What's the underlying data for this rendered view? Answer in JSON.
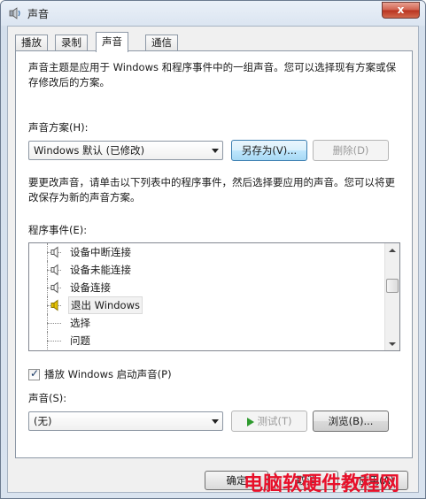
{
  "window": {
    "title": "声音",
    "close_glyph": "x"
  },
  "tabs": [
    {
      "label": "播放"
    },
    {
      "label": "录制"
    },
    {
      "label": "声音"
    },
    {
      "label": "通信"
    }
  ],
  "sound_panel": {
    "intro_text": "声音主题是应用于 Windows 和程序事件中的一组声音。您可以选择现有方案或保存修改后的方案。",
    "scheme_label": "声音方案(H):",
    "scheme_value": "Windows 默认 (已修改)",
    "save_as_label": "另存为(V)...",
    "delete_label": "删除(D)",
    "instructions_text": "要更改声音，请单击以下列表中的程序事件，然后选择要应用的声音。您可以将更改保存为新的声音方案。",
    "events_label": "程序事件(E):",
    "events": [
      {
        "label": "设备中断连接",
        "has_sound": true,
        "selected": false
      },
      {
        "label": "设备未能连接",
        "has_sound": true,
        "selected": false
      },
      {
        "label": "设备连接",
        "has_sound": true,
        "selected": false
      },
      {
        "label": "退出 Windows",
        "has_sound": true,
        "selected": true
      },
      {
        "label": "选择",
        "has_sound": false,
        "selected": false
      },
      {
        "label": "问题",
        "has_sound": false,
        "selected": false
      }
    ],
    "startup_checkbox_label": "播放 Windows 启动声音(P)",
    "startup_checked": true,
    "sound_label": "声音(S):",
    "sound_value": "(无)",
    "test_label": "测试(T)",
    "browse_label": "浏览(B)..."
  },
  "footer": {
    "ok_label": "确定",
    "cancel_label": "取消",
    "apply_label": "应用(A)"
  },
  "watermark": "电脑软硬件教程网",
  "colors": {
    "watermark": "#e8102a",
    "selected_speaker": "#e8c400",
    "test_play": "#2e9a2e"
  }
}
